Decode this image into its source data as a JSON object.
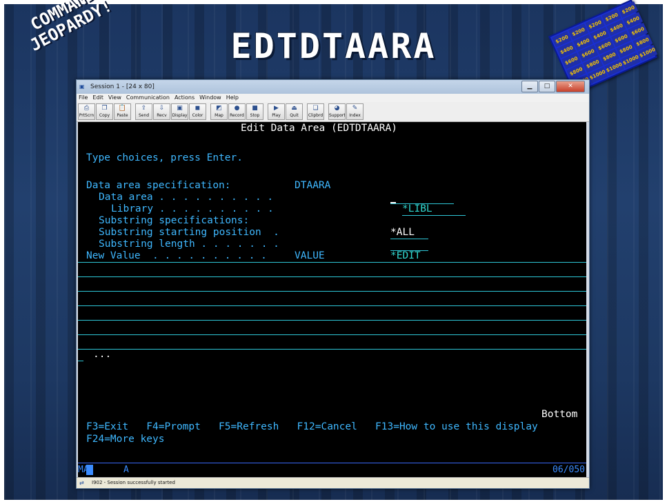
{
  "slide": {
    "title": "EDTDTAARA",
    "banner_line1": "COMMAND",
    "banner_line2": "JEOPARDY!",
    "board_values": [
      "$200",
      "$200",
      "$200",
      "$200",
      "$200",
      "$400",
      "$400",
      "$400",
      "$400",
      "$400",
      "$600",
      "$600",
      "$600",
      "$600",
      "$600",
      "$800",
      "$800",
      "$800",
      "$800",
      "$800",
      "$1000",
      "$1000",
      "$1000",
      "$1000",
      "$1000"
    ]
  },
  "window": {
    "title": "Session 1 - [24 x 80]",
    "menu": [
      "File",
      "Edit",
      "View",
      "Communication",
      "Actions",
      "Window",
      "Help"
    ],
    "toolbar": [
      {
        "label": "PrtScrn",
        "icon": "printer-icon"
      },
      {
        "label": "Copy",
        "icon": "copy-icon"
      },
      {
        "label": "Paste",
        "icon": "paste-icon"
      },
      {
        "label": "Send",
        "icon": "send-icon"
      },
      {
        "label": "Recv",
        "icon": "receive-icon"
      },
      {
        "label": "Display",
        "icon": "display-icon"
      },
      {
        "label": "Color",
        "icon": "color-icon"
      },
      {
        "label": "Map",
        "icon": "map-icon"
      },
      {
        "label": "Record",
        "icon": "record-icon"
      },
      {
        "label": "Stop",
        "icon": "stop-icon"
      },
      {
        "label": "Play",
        "icon": "play-icon"
      },
      {
        "label": "Quit",
        "icon": "quit-icon"
      },
      {
        "label": "Clipbrd",
        "icon": "clipboard-icon"
      },
      {
        "label": "Support",
        "icon": "support-icon"
      },
      {
        "label": "Index",
        "icon": "index-icon"
      }
    ],
    "status_text": "I902 - Session successfully started"
  },
  "screen": {
    "heading": "Edit Data Area (EDTDTAARA)",
    "instructions": "Type choices, press Enter.",
    "fields": {
      "spec_label": "Data area specification:",
      "spec_keyword": "DTAARA",
      "data_area_label": "Data area . . . . . . . . . .",
      "library_label": "Library . . . . . . . . . .",
      "library_value": "*LIBL",
      "substring_spec_label": "Substring specifications:",
      "start_pos_label": "Substring starting position  .",
      "start_pos_value": "*ALL",
      "length_label": "Substring length . . . . . . .",
      "new_value_label": "New Value  . . . . . . . . . .",
      "new_value_keyword": "VALUE",
      "new_value_value": "*EDIT"
    },
    "more": "...",
    "bottom": "Bottom",
    "fkeys_line1": "F3=Exit   F4=Prompt   F5=Refresh   F12=Cancel   F13=How to use this display",
    "fkeys_line2": "F24=More keys"
  },
  "oia": {
    "mode": "MA",
    "indicator": "A",
    "position": "06/050"
  }
}
